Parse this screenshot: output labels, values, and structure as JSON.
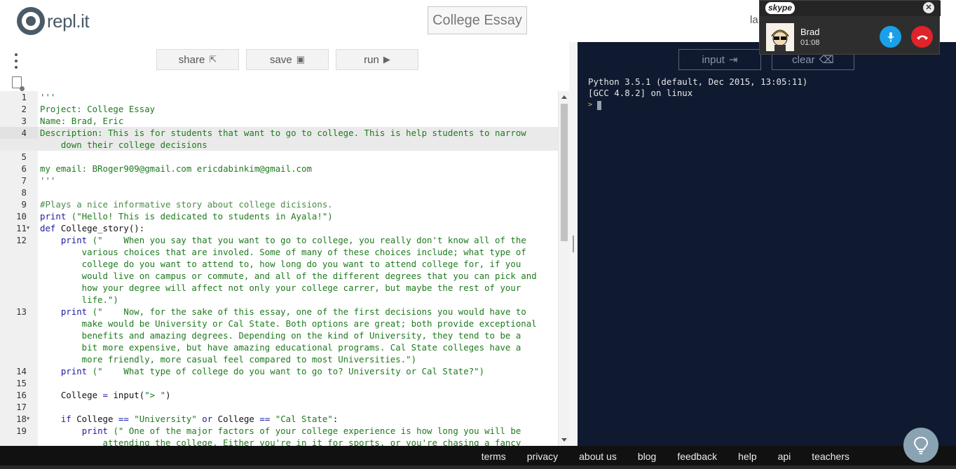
{
  "header": {
    "logo_text": "repl.it",
    "title": "College Essay",
    "right_text": "la"
  },
  "toolbar": {
    "share_label": "share",
    "save_label": "save",
    "run_label": "run"
  },
  "editor": {
    "active_line": 4,
    "lines": [
      {
        "num": "1",
        "text": "'''",
        "color": "green",
        "fold": false
      },
      {
        "num": "2",
        "text": "Project: College Essay",
        "color": "green",
        "fold": false
      },
      {
        "num": "3",
        "text": "Name: Brad, Eric",
        "color": "green",
        "fold": false
      },
      {
        "num": "4",
        "text": "Description: This is for students that want to go to college. This is help students to narrow",
        "color": "green",
        "fold": false
      },
      {
        "num": "",
        "text": "    down their college decisions",
        "color": "green",
        "fold": false
      },
      {
        "num": "5",
        "text": "",
        "color": "green",
        "fold": false
      },
      {
        "num": "6",
        "text": "my email: BRoger909@gmail.com ericdabinkim@gmail.com",
        "color": "green",
        "fold": false
      },
      {
        "num": "7",
        "text": "'''",
        "color": "green",
        "fold": false
      },
      {
        "num": "8",
        "text": "",
        "color": "green",
        "fold": false
      },
      {
        "num": "9",
        "text": "#Plays a nice informative story about college dicisions.",
        "color": "comment",
        "fold": false
      },
      {
        "num": "10",
        "text": "",
        "color": "mixed",
        "fold": false
      },
      {
        "num": "11",
        "text": "",
        "color": "mixed",
        "fold": true
      },
      {
        "num": "12",
        "text": "",
        "color": "mixed",
        "fold": false
      },
      {
        "num": "",
        "text": "        various choices that are involed. Some of many of these choices include; what type of",
        "color": "green",
        "fold": false
      },
      {
        "num": "",
        "text": "        college do you want to attend to, how long do you want to attend college for, if you",
        "color": "green",
        "fold": false
      },
      {
        "num": "",
        "text": "        would live on campus or commute, and all of the different degrees that you can pick and",
        "color": "green",
        "fold": false
      },
      {
        "num": "",
        "text": "        how your degree will affect not only your college carrer, but maybe the rest of your",
        "color": "green",
        "fold": false
      },
      {
        "num": "",
        "text": "        life.\")",
        "color": "green",
        "fold": false
      },
      {
        "num": "13",
        "text": "",
        "color": "mixed",
        "fold": false
      },
      {
        "num": "",
        "text": "        make would be University or Cal State. Both options are great; both provide exceptional",
        "color": "green",
        "fold": false
      },
      {
        "num": "",
        "text": "        benefits and amazing degrees. Depending on the kind of University, they tend to be a",
        "color": "green",
        "fold": false
      },
      {
        "num": "",
        "text": "        bit more expensive, but have amazing educational programs. Cal State colleges have a",
        "color": "green",
        "fold": false
      },
      {
        "num": "",
        "text": "        more friendly, more casual feel compared to most Universities.\")",
        "color": "green",
        "fold": false
      },
      {
        "num": "14",
        "text": "",
        "color": "mixed",
        "fold": false
      },
      {
        "num": "15",
        "text": "",
        "color": "green",
        "fold": false
      },
      {
        "num": "16",
        "text": "",
        "color": "mixed",
        "fold": false
      },
      {
        "num": "17",
        "text": "",
        "color": "green",
        "fold": false
      },
      {
        "num": "18",
        "text": "",
        "color": "mixed",
        "fold": true
      },
      {
        "num": "19",
        "text": "",
        "color": "mixed",
        "fold": false
      },
      {
        "num": "",
        "text": "            attending the college. Either you're in it for sports, or you're chasing a fancy",
        "color": "green",
        "fold": false
      }
    ],
    "mixed": {
      "10": [
        [
          "kw",
          "print"
        ],
        [
          "str",
          " (\"Hello! This is dedicated to students in Ayala!\")"
        ]
      ],
      "11": [
        [
          "kw",
          "def"
        ],
        [
          "plain",
          " College_story():"
        ]
      ],
      "12": [
        [
          "plain",
          "    "
        ],
        [
          "kw",
          "print"
        ],
        [
          "str",
          " (\"    When you say that you want to go to college, you really don't know all of the"
        ]
      ],
      "13": [
        [
          "plain",
          "    "
        ],
        [
          "kw",
          "print"
        ],
        [
          "str",
          " (\"    Now, for the sake of this essay, one of the first decisions you would have to"
        ]
      ],
      "14": [
        [
          "plain",
          "    "
        ],
        [
          "kw",
          "print"
        ],
        [
          "str",
          " (\"    What type of college do you want to go to? University or Cal State?\")"
        ]
      ],
      "16": [
        [
          "plain",
          "    College "
        ],
        [
          "kw",
          "="
        ],
        [
          "plain",
          " input("
        ],
        [
          "str",
          "\"> \""
        ],
        [
          "plain",
          ")"
        ]
      ],
      "18": [
        [
          "plain",
          "    "
        ],
        [
          "kw",
          "if"
        ],
        [
          "plain",
          " College "
        ],
        [
          "kw",
          "=="
        ],
        [
          "plain",
          " "
        ],
        [
          "str",
          "\"University\""
        ],
        [
          "plain",
          " "
        ],
        [
          "kw",
          "or"
        ],
        [
          "plain",
          " College "
        ],
        [
          "kw",
          "=="
        ],
        [
          "plain",
          " "
        ],
        [
          "str",
          "\"Cal State\""
        ],
        [
          "plain",
          ":"
        ]
      ],
      "19": [
        [
          "plain",
          "        "
        ],
        [
          "kw",
          "print"
        ],
        [
          "str",
          " (\" One of the major factors of your college experience is how long you will be"
        ]
      ]
    }
  },
  "console": {
    "input_label": "input",
    "clear_label": "clear",
    "line1": "Python 3.5.1 (default, Dec 2015, 13:05:11)",
    "line2": "[GCC 4.8.2] on linux",
    "prompt": ">"
  },
  "footer": {
    "links": [
      "terms",
      "privacy",
      "about us",
      "blog",
      "feedback",
      "help",
      "api",
      "teachers"
    ]
  },
  "skype": {
    "logo": "skype",
    "caller_name": "Brad",
    "call_time": "01:08"
  },
  "colors": {
    "console_bg": "#0f1a30",
    "code_green": "#1e7a1e",
    "keyword_blue": "#1a1aa6",
    "mic_blue": "#1aa0e8",
    "end_red": "#e0222a"
  }
}
